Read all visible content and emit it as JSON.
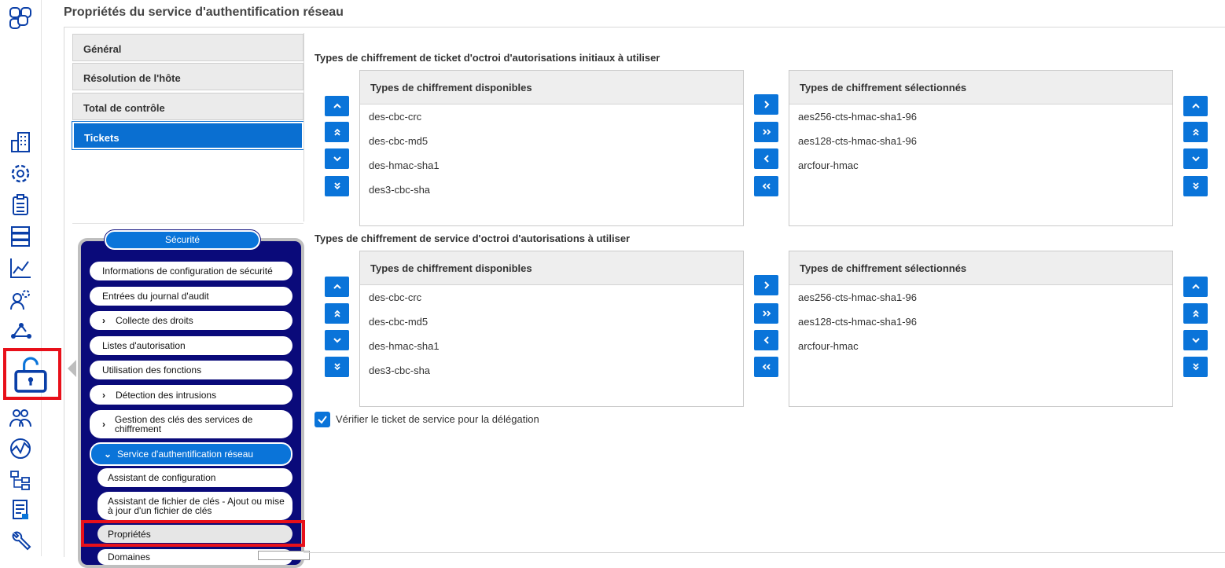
{
  "header": {
    "title": "Propriétés du service d'authentification réseau"
  },
  "tabs": [
    {
      "label": "Général",
      "active": false
    },
    {
      "label": "Résolution de l'hôte",
      "active": false
    },
    {
      "label": "Total de contrôle",
      "active": false
    },
    {
      "label": "Tickets",
      "active": true
    }
  ],
  "section1": {
    "title": "Types de chiffrement de ticket d'octroi d'autorisations initiaux à utiliser",
    "available": {
      "header": "Types de chiffrement disponibles",
      "items": [
        "des-cbc-crc",
        "des-cbc-md5",
        "des-hmac-sha1",
        "des3-cbc-sha"
      ]
    },
    "selected": {
      "header": "Types de chiffrement sélectionnés",
      "items": [
        "aes256-cts-hmac-sha1-96",
        "aes128-cts-hmac-sha1-96",
        "arcfour-hmac"
      ]
    }
  },
  "section2": {
    "title": "Types de chiffrement de service d'octroi d'autorisations à utiliser",
    "available": {
      "header": "Types de chiffrement disponibles",
      "items": [
        "des-cbc-crc",
        "des-cbc-md5",
        "des-hmac-sha1",
        "des3-cbc-sha"
      ]
    },
    "selected": {
      "header": "Types de chiffrement sélectionnés",
      "items": [
        "aes256-cts-hmac-sha1-96",
        "aes128-cts-hmac-sha1-96",
        "arcfour-hmac"
      ]
    }
  },
  "verify": {
    "label": "Vérifier le ticket de service pour la délégation",
    "checked": true
  },
  "security_menu": {
    "title": "Sécurité",
    "items": [
      {
        "label": "Informations de configuration de sécurité"
      },
      {
        "label": "Entrées du journal d'audit"
      },
      {
        "label": "Collecte des droits"
      },
      {
        "label": "Listes d'autorisation"
      },
      {
        "label": "Utilisation des fonctions"
      },
      {
        "label": "Détection des intrusions"
      },
      {
        "label": "Gestion des clés des services de chiffrement"
      },
      {
        "label": "Service d'authentification réseau"
      },
      {
        "label": "Assistant de configuration"
      },
      {
        "label": "Assistant de fichier de clés - Ajout ou mise à jour d'un fichier de clés"
      },
      {
        "label": "Propriétés"
      },
      {
        "label": "Domaines"
      }
    ]
  },
  "colors": {
    "accent": "#0a74d9",
    "panel": "#0a0a7a",
    "highlight": "#e8101a"
  }
}
